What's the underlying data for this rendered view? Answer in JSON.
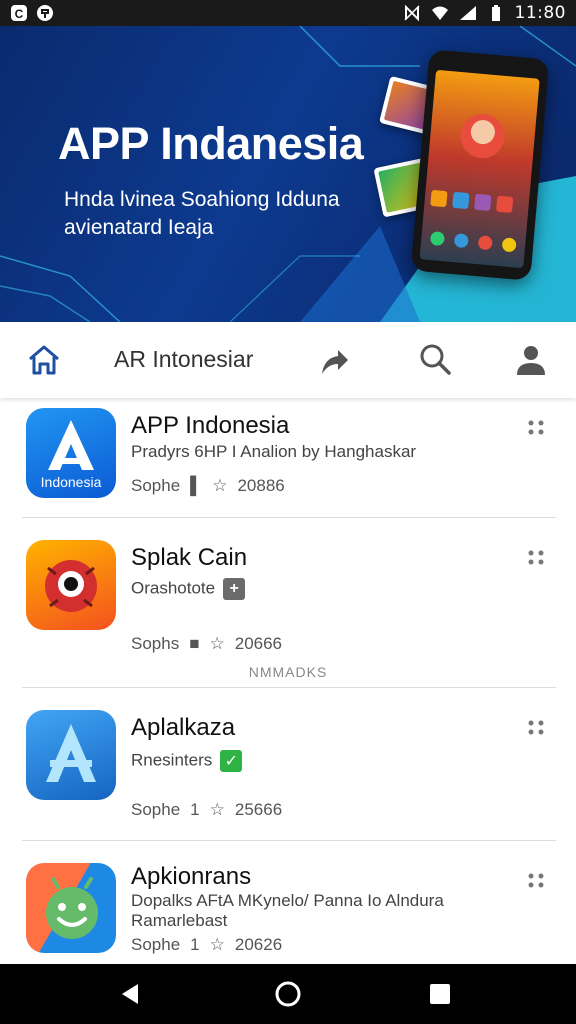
{
  "status_bar": {
    "time": "11:80",
    "left_icons": [
      "app-c-icon",
      "notification-icon"
    ],
    "right_icons": [
      "nfc-icon",
      "wifi-icon",
      "signal-icon",
      "battery-icon"
    ]
  },
  "banner": {
    "title": "APP Indanesia",
    "subtitle": "Hnda lvinea Soahiong Idduna avienatard Ieaja"
  },
  "nav": {
    "home_icon": "home-icon",
    "label": "AR Intonesiar",
    "share_icon": "share-arrow-icon",
    "search_icon": "search-icon",
    "profile_icon": "profile-icon"
  },
  "apps": [
    {
      "name": "APP Indonesia",
      "developer": "Pradyrs 6HP I Analion by Hanghaskar",
      "icon_label": "Indonesia",
      "meta_label": "Sophe",
      "meta_mark": "▌",
      "rating": "20886"
    },
    {
      "name": "Splak Cain",
      "developer": "Orashotote",
      "badge": "+",
      "meta_label": "Sophs",
      "meta_mark": "■",
      "rating": "20666",
      "section_note": "NMMADKS"
    },
    {
      "name": "Aplalkaza",
      "developer": "Rnesinters",
      "badge": "✓",
      "meta_label": "Sophe",
      "meta_mark": "1",
      "rating": "25666"
    },
    {
      "name": "Apkionrans",
      "developer": "Dopalks AFtA MKynelo/ Panna Io Alndura",
      "developer_line2": "Ramarlebast",
      "meta_label": "Sophe",
      "meta_mark": "1",
      "rating": "20626"
    }
  ],
  "colors": {
    "banner_bg": "#0d3a8f",
    "accent_cyan": "#27c5e0",
    "nav_icon": "#1e4fa0",
    "badge_gray": "#6b6b6b",
    "badge_green": "#2fb344"
  }
}
